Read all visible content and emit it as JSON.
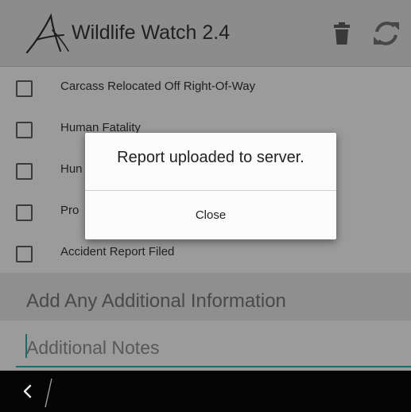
{
  "header": {
    "title": "Wildlife Watch 2.4",
    "logo_icon": "wildlife-watch-logo",
    "actions": [
      {
        "icon": "trash-icon",
        "label": "Delete"
      },
      {
        "icon": "refresh-icon",
        "label": "Refresh"
      }
    ]
  },
  "checklist": {
    "items": [
      {
        "label": "Carcass Relocated Off Right-Of-Way",
        "checked": false
      },
      {
        "label": "Human Fatality",
        "checked": false
      },
      {
        "label": "Hun",
        "checked": false
      },
      {
        "label": "Pro",
        "checked": false
      },
      {
        "label": "Accident Report Filed",
        "checked": false
      }
    ]
  },
  "additional": {
    "section_title": "Add Any Additional Information",
    "notes_placeholder": "Additional Notes"
  },
  "dialog": {
    "message": "Report uploaded to server.",
    "close_label": "Close"
  },
  "navbar": {
    "back_icon": "back-chevron-icon"
  },
  "colors": {
    "accent": "#35a3a3",
    "actionbar": "#dcdcdc",
    "navbar": "#050505",
    "dialog": "#fbfbfb"
  }
}
